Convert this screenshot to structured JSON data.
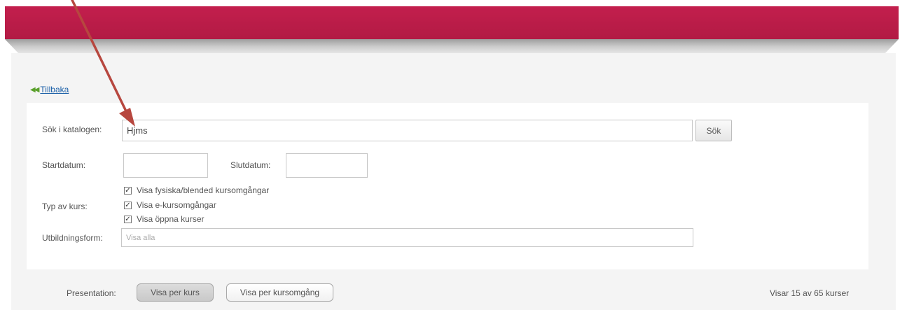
{
  "back_link": {
    "icon": "double-left-arrow-icon",
    "label": "Tillbaka"
  },
  "search": {
    "label": "Sök i katalogen:",
    "value": "Hjms",
    "button_label": "Sök"
  },
  "dates": {
    "start_label": "Startdatum:",
    "start_value": "",
    "end_label": "Slutdatum:",
    "end_value": ""
  },
  "course_type": {
    "label": "Typ av kurs:",
    "options": [
      {
        "label": "Visa fysiska/blended kursomgångar",
        "checked": true
      },
      {
        "label": "Visa e-kursomgångar",
        "checked": true
      },
      {
        "label": "Visa öppna kurser",
        "checked": true
      }
    ]
  },
  "education_form": {
    "label": "Utbildningsform:",
    "placeholder": "Visa alla"
  },
  "presentation": {
    "label": "Presentation:",
    "options": [
      "Visa per kurs",
      "Visa per kursomgång"
    ],
    "active_index": 0,
    "result_count": "Visar 15 av 65 kurser"
  },
  "colors": {
    "header": "#b91c48",
    "annotation_arrow": "#b7473f",
    "link": "#1a5fa8"
  }
}
